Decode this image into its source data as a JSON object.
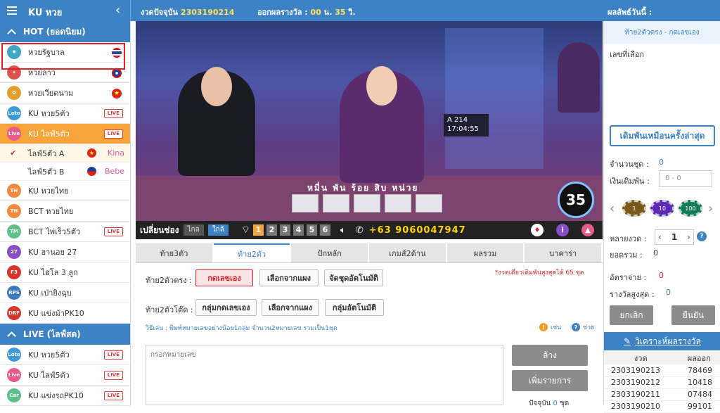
{
  "header": {
    "app_title": "KU หวย",
    "round_label": "งวดปัจจุบัน",
    "round_number": "2303190214",
    "countdown_label": "ออกผลรางวัล :",
    "countdown_min": "00",
    "countdown_min_unit": "น.",
    "countdown_sec": "35",
    "countdown_sec_unit": "วิ.",
    "results_title": "ผลลัพธ์วันนี้ :"
  },
  "sidebar": {
    "hot_header": "HOT (ยอดนิยม)",
    "hot_items": [
      {
        "label": "หวยรัฐบาล",
        "icon": "gear-icon",
        "flag": "thai-flag"
      },
      {
        "label": "หวยลาว",
        "icon": "lao-icon",
        "flag": "lao-flag"
      },
      {
        "label": "หวยเวียดนาม",
        "icon": "vn-icon",
        "flag": "vietnam-flag"
      },
      {
        "label": "KU หวย5ตัว",
        "icon_text": "Loto",
        "live": "LIVE"
      },
      {
        "label": "KU ไลฟ์5ตัว",
        "icon_text": "Live",
        "live": "LIVE"
      },
      {
        "label": "KU หวยไทย",
        "icon_text": "TH"
      },
      {
        "label": "BCT หวยไทย",
        "icon_text": "TH"
      },
      {
        "label": "BCT ไพ่เร็ว5ตัว",
        "icon_text": "TM",
        "live": "LIVE"
      },
      {
        "label": "KU ฮานอย 27",
        "icon_text": "27"
      },
      {
        "label": "KU ไฮโล 3 ลูก",
        "icon_text": "F3"
      },
      {
        "label": "KU เป่ายิงฉุบ",
        "icon_text": "RPS"
      },
      {
        "label": "KU แข่งม้าPK10",
        "icon_text": "DRF"
      }
    ],
    "sub_items": [
      {
        "label": "ไลฟ์5ตัว A",
        "dealer": "Kina"
      },
      {
        "label": "ไลฟ์5ตัว B",
        "dealer": "Bebe"
      }
    ],
    "live_header": "LIVE (ไลฟ์สด)",
    "live_items": [
      {
        "label": "KU หวย5ตัว",
        "icon_text": "Loto",
        "live": "LIVE"
      },
      {
        "label": "KU ไลฟ์5ตัว",
        "icon_text": "Live",
        "live": "LIVE"
      },
      {
        "label": "KU แข่งรถPK10",
        "icon_text": "Car",
        "live": "LIVE"
      }
    ]
  },
  "video": {
    "board_label": "หมื่น พัน ร้อย สิบ หน่วย",
    "info_line1": "A   214",
    "info_line2": "17:04:55",
    "timer": "35",
    "channel_label": "เปลี่ยนช่อง",
    "far_label": "ไกล",
    "near_label": "ใกล้",
    "channels": [
      "1",
      "2",
      "3",
      "4",
      "5",
      "6"
    ],
    "phone": "+63 9060047947"
  },
  "tabs": [
    "ท้าย3ตัว",
    "ท้าย2ตัว",
    "ปักหลัก",
    "เกมส์2ด้าน",
    "ผลรวม",
    "บาคาร่า"
  ],
  "form": {
    "row1_label": "ท้าย2ตัวตรง :",
    "row1_buttons": [
      "กดเลขเอง",
      "เลือกจากแผง",
      "จัดชุดอัตโนมัติ"
    ],
    "row2_label": "ท้าย2ตัวโต๊ด :",
    "row2_buttons": [
      "กลุ่มกดเลขเอง",
      "เลือกจากแผง",
      "กลุ่มอัตโนมัติ"
    ],
    "warning": "*งวดเดียวเดิมพันสูงสุดได้ 65 ชุด",
    "howto": "วิธีเล่น : พิมพ์หมายเลขอย่างน้อย1กลุ่ม จำนวน2หมายเลข รวมเป็น1ชุด",
    "example": "เช่น",
    "help": "ช่วย",
    "textarea_placeholder": "กรอกหมายเลข",
    "clear_button": "ล้าง",
    "add_button": "เพิ่มรายการ",
    "current_label": "ปัจจุบัน",
    "current_value": "0",
    "current_unit": "ชุด"
  },
  "right": {
    "subtitle": "ท้าย2ตัวตรง - กดเลขเอง",
    "picked_label": "เลขที่เลือก",
    "repeat_button": "เดิมพันเหมือนครั้งล่าสุด",
    "sets_label": "จำนวนชุด :",
    "sets_value": "0",
    "bet_label": "เงินเดิมพัน :",
    "bet_placeholder": "0 - 0",
    "chips": [
      "1",
      "10",
      "100"
    ],
    "multi_label": "หลายงวด :",
    "multi_value": "1",
    "total_label": "ยอดรวม :",
    "total_value": "0",
    "rate_label": "อัตราจ่าย :",
    "rate_value": "0",
    "max_label": "รางวัลสูงสุด :",
    "max_value": "0",
    "cancel_button": "ยกเลิก",
    "confirm_button": "ยืนยัน",
    "analyze_link": "วิเคราะห์ผลรางวัล",
    "table_headers": [
      "งวด",
      "ผลออก"
    ],
    "rows": [
      [
        "2303190213",
        "78469"
      ],
      [
        "2303190212",
        "10418"
      ],
      [
        "2303190211",
        "07484"
      ],
      [
        "2303190210",
        "99101"
      ]
    ]
  }
}
